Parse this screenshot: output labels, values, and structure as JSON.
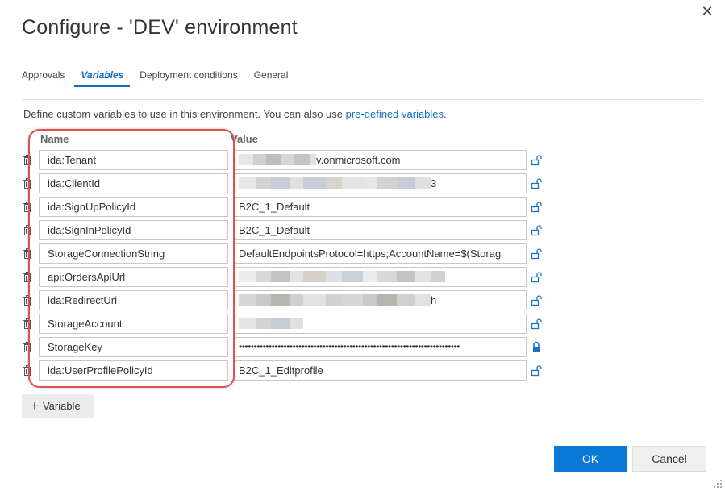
{
  "dialog": {
    "title": "Configure - 'DEV' environment",
    "close_icon": "close-icon"
  },
  "tabs": [
    {
      "label": "Approvals",
      "active": false
    },
    {
      "label": "Variables",
      "active": true
    },
    {
      "label": "Deployment conditions",
      "active": false
    },
    {
      "label": "General",
      "active": false
    }
  ],
  "description": {
    "text": "Define custom variables to use in this environment. You can also use ",
    "link": "pre-defined variables."
  },
  "columns": {
    "name": "Name",
    "value": "Value"
  },
  "variables": [
    {
      "name": "ida:Tenant",
      "value": "v.onmicrosoft.com",
      "redacted": true,
      "secret": false
    },
    {
      "name": "ida:ClientId",
      "value": "3",
      "redacted": true,
      "secret": false
    },
    {
      "name": "ida:SignUpPolicyId",
      "value": "B2C_1_Default",
      "redacted": false,
      "secret": false
    },
    {
      "name": "ida:SignInPolicyId",
      "value": "B2C_1_Default",
      "redacted": false,
      "secret": false
    },
    {
      "name": "StorageConnectionString",
      "value": "DefaultEndpointsProtocol=https;AccountName=$(Storag",
      "redacted": false,
      "secret": false
    },
    {
      "name": "api:OrdersApiUrl",
      "value": "",
      "redacted": true,
      "secret": false
    },
    {
      "name": "ida:RedirectUri",
      "value": "h",
      "redacted": true,
      "secret": false
    },
    {
      "name": "StorageAccount",
      "value": "",
      "redacted": true,
      "secret": false
    },
    {
      "name": "StorageKey",
      "value": "••••••••••••••••••••••••••••••••••••••••••••••••••••••••••••••••••••••••••",
      "redacted": false,
      "secret": true
    },
    {
      "name": "ida:UserProfilePolicyId",
      "value": "B2C_1_Editprofile",
      "redacted": false,
      "secret": false
    }
  ],
  "icons": {
    "delete": "trash-icon",
    "unlocked": "unlock-icon",
    "locked": "lock-icon"
  },
  "buttons": {
    "add_variable": "Variable",
    "ok": "OK",
    "cancel": "Cancel"
  },
  "colors": {
    "accent": "#0a78d7",
    "link": "#106ebe",
    "highlight": "#d9534f"
  }
}
